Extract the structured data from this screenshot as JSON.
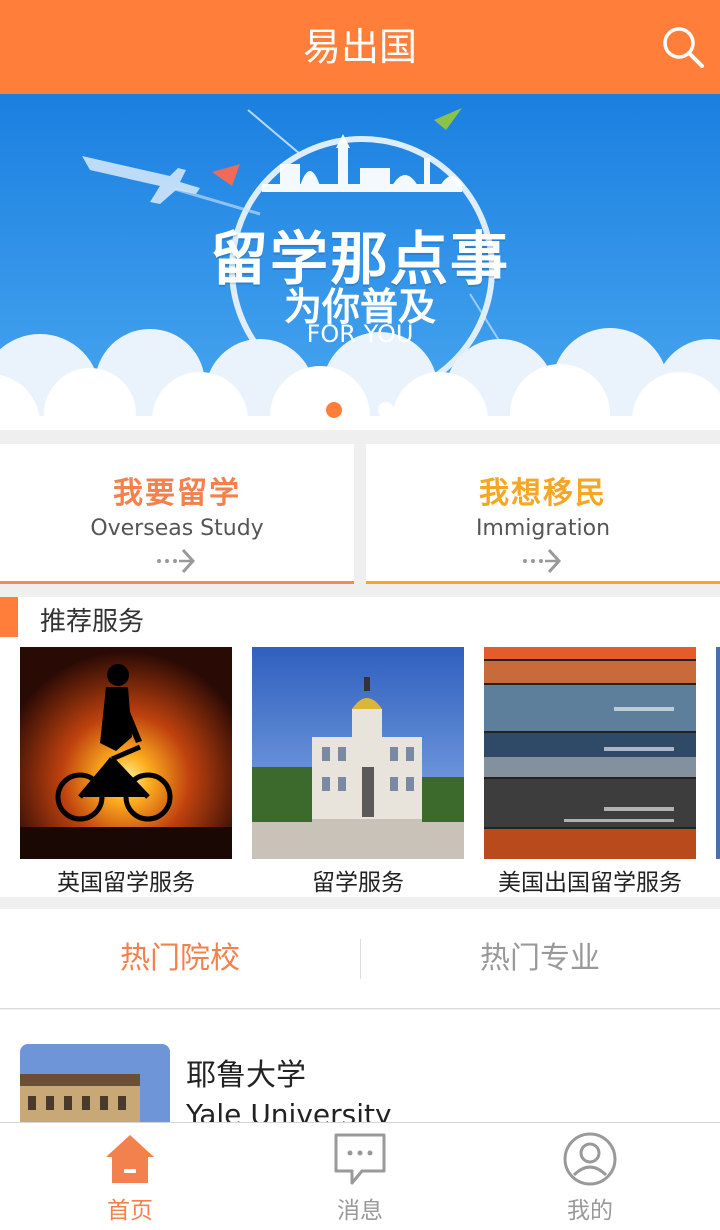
{
  "header": {
    "title": "易出国"
  },
  "banner": {
    "title": "留学那点事",
    "subtitle": "为你普及",
    "tagline": "FOR YOU"
  },
  "cards": {
    "study": {
      "title": "我要留学",
      "subtitle": "Overseas Study"
    },
    "immigration": {
      "title": "我想移民",
      "subtitle": "Immigration"
    }
  },
  "recommend": {
    "title": "推荐服务",
    "items": [
      {
        "label": "英国留学服务"
      },
      {
        "label": "留学服务"
      },
      {
        "label": "美国出国留学服务"
      }
    ]
  },
  "tabs": [
    {
      "label": "热门院校",
      "active": true
    },
    {
      "label": "热门专业",
      "active": false
    }
  ],
  "school": {
    "name_cn": "耶鲁大学",
    "name_en": "Yale University"
  },
  "tabbar": [
    {
      "label": "首页",
      "icon": "home-icon",
      "active": true
    },
    {
      "label": "消息",
      "icon": "message-icon",
      "active": false
    },
    {
      "label": "我的",
      "icon": "profile-icon",
      "active": false
    }
  ],
  "colors": {
    "accent": "#ff7f3a",
    "immigration": "#f5a623",
    "banner": "#1e88e5"
  }
}
